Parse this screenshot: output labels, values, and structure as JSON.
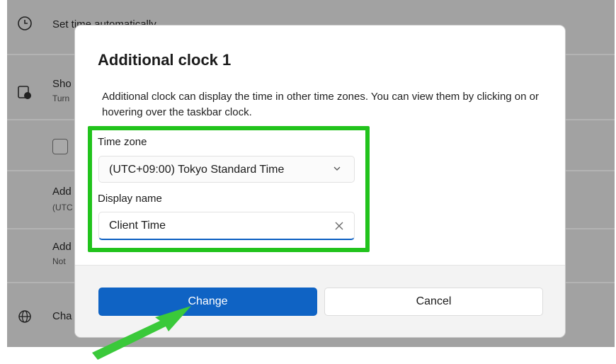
{
  "background": {
    "rows": [
      {
        "title": "Set time automatically",
        "subtitle": ""
      },
      {
        "title": "Sho",
        "subtitle": "Turn"
      },
      {
        "title": "",
        "subtitle": ""
      },
      {
        "title": "Add",
        "subtitle": "(UTC"
      },
      {
        "title": "Add",
        "subtitle": "Not"
      },
      {
        "title": "Cha",
        "subtitle": ""
      }
    ]
  },
  "dialog": {
    "title": "Additional clock 1",
    "description": "Additional clock can display the time in other time zones. You can view them by clicking on or hovering over the taskbar clock.",
    "time_zone_label": "Time zone",
    "time_zone_value": "(UTC+09:00) Tokyo Standard Time",
    "display_name_label": "Display name",
    "display_name_value": "Client Time",
    "change_button": "Change",
    "cancel_button": "Cancel"
  },
  "colors": {
    "accent": "#0f63c4",
    "highlight": "#21c31c",
    "overlay": "#a2a2a2"
  }
}
